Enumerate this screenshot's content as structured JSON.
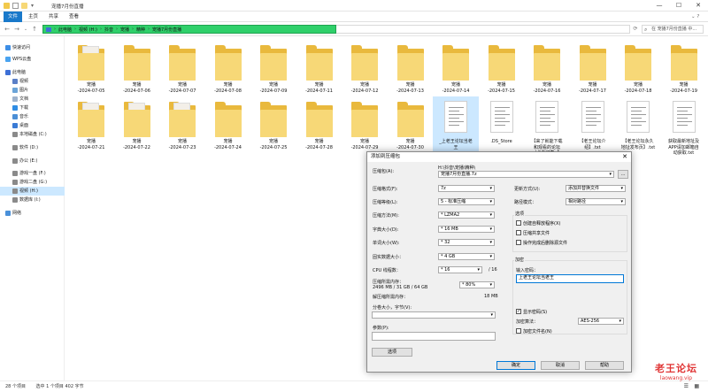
{
  "window": {
    "title": "宠播7月份直播"
  },
  "ribbon": {
    "tabs": [
      "文件",
      "主页",
      "共享",
      "查看"
    ]
  },
  "address": {
    "segments": [
      "此电脑",
      "视频 (H:)",
      "抖音",
      "宠播",
      "精种",
      "宠播7月份直播"
    ],
    "search_placeholder": "在 宠播7月份直播 中..."
  },
  "nav": {
    "items": [
      "快速访问",
      "WPS云盘",
      "此电脑",
      "视频",
      "图片",
      "文档",
      "下载",
      "音乐",
      "桌面",
      "本地磁盘 (C:)",
      "软件 (D:)",
      "办公 (E:)",
      "游戏一盘 (F:)",
      "游戏二盘 (G:)",
      "视频 (H:)",
      "数据库 (I:)",
      "网络"
    ]
  },
  "files": {
    "row1": [
      {
        "name": "宠播\n-2024-07-05",
        "kind": "photo"
      },
      {
        "name": "宠播\n-2024-07-06",
        "kind": "folder"
      },
      {
        "name": "宠播\n-2024-07-07",
        "kind": "folder"
      },
      {
        "name": "宠播\n-2024-07-08",
        "kind": "folder"
      },
      {
        "name": "宠播\n-2024-07-09",
        "kind": "folder"
      },
      {
        "name": "宠播\n-2024-07-11",
        "kind": "folder"
      },
      {
        "name": "宠播\n-2024-07-12",
        "kind": "folder"
      },
      {
        "name": "宠播\n-2024-07-13",
        "kind": "folder"
      },
      {
        "name": "宠播\n-2024-07-14",
        "kind": "folder"
      },
      {
        "name": "宠播\n-2024-07-15",
        "kind": "folder"
      },
      {
        "name": "宠播\n-2024-07-16",
        "kind": "folder"
      },
      {
        "name": "宠播\n-2024-07-17",
        "kind": "folder"
      },
      {
        "name": "宠播\n-2024-07-18",
        "kind": "folder"
      },
      {
        "name": "宠播\n-2024-07-19",
        "kind": "folder"
      }
    ],
    "row2": [
      {
        "name": "宠播\n-2024-07-21",
        "kind": "photo"
      },
      {
        "name": "宠播\n-2024-07-22",
        "kind": "photo"
      },
      {
        "name": "宠播\n-2024-07-23",
        "kind": "photo"
      },
      {
        "name": "宠播\n-2024-07-24",
        "kind": "folder"
      },
      {
        "name": "宠播\n-2024-07-25",
        "kind": "folder"
      },
      {
        "name": "宠播\n-2024-07-28",
        "kind": "folder"
      },
      {
        "name": "宠播\n-2024-07-29",
        "kind": "folder"
      },
      {
        "name": "宠播\n-2024-07-30",
        "kind": "folder"
      },
      {
        "name": "_上老王论坛当老\n王",
        "kind": "doc",
        "selected": true
      },
      {
        "name": ".DS_Store",
        "kind": "doc"
      },
      {
        "name": "【来了就能下载\n和观看的论坛\n（点击可直..】",
        "kind": "doc"
      },
      {
        "name": "【老王论坛介\n绍】.txt",
        "kind": "doc"
      },
      {
        "name": "【老王论坛永久\n地址发布页】.txt",
        "kind": "doc"
      },
      {
        "name": "获取最新地址及\nAPP请加邮箱自\n动获取.txt",
        "kind": "doc"
      }
    ]
  },
  "status": {
    "count": "28 个项目",
    "selected": "选中 1 个项目  402 字节"
  },
  "dialog": {
    "title": "添加到压缩包",
    "archive_label": "压缩包(A):",
    "archive_path": "H:\\抖音\\宠播\\精种\\",
    "archive_name": "宠播7月份直播.7z",
    "browse": "...",
    "format_label": "压缩格式(F):",
    "format_value": "7z",
    "level_label": "压缩等级(L):",
    "level_value": "5 - 标准压缩",
    "method_label": "压缩方法(M):",
    "method_value": "* LZMA2",
    "dict_label": "字典大小(D):",
    "dict_value": "* 16 MB",
    "word_label": "单词大小(W):",
    "word_value": "* 32",
    "solid_label": "固实数据大小：",
    "solid_value": "* 4 GB",
    "cpu_label": "CPU 线程数：",
    "cpu_value": "* 16",
    "cpu_max": "/ 16",
    "mem_label": "压缩所需内存：",
    "mem_value": "2496 MB / 31 GB / 64 GB",
    "mem_pct": "* 80%",
    "demem_label": "解压缩所需内存：",
    "demem_value": "18 MB",
    "split_label": "分卷大小，字节(V):",
    "params_label": "参数(P):",
    "options_button": "选项",
    "update_label": "更新方式(U):",
    "update_value": "添加并替换文件",
    "pathmode_label": "路径模式：",
    "pathmode_value": "相对路径",
    "opts_title": "选项",
    "opt1": "创建自释放程序(X)",
    "opt2": "压缩共享文件",
    "opt3": "操作完成后删除源文件",
    "enc_title": "加密",
    "pwd_label": "输入密码：",
    "pwd_value": "上老王论坛当老王",
    "show_pwd": "显示密码(S)",
    "enc_method_label": "加密算法：",
    "enc_method_value": "AES-256",
    "enc_names": "加密文件名(N)",
    "ok": "确定",
    "cancel": "取消",
    "help": "帮助"
  },
  "watermark": {
    "line1": "老王论坛",
    "line2": "laowang.vip"
  }
}
